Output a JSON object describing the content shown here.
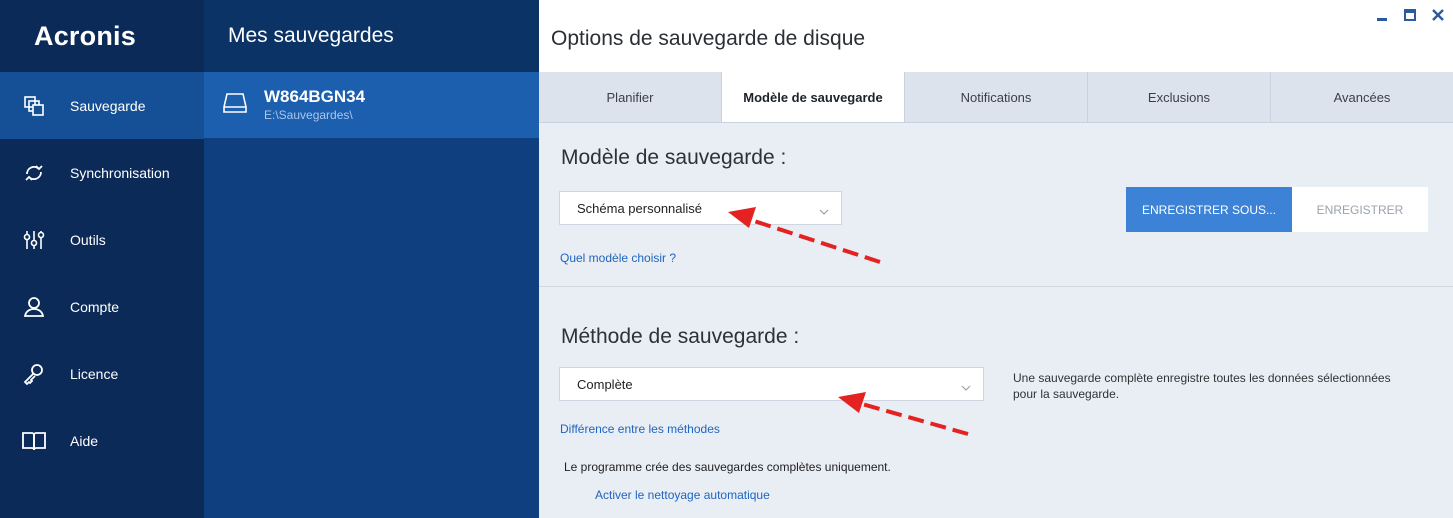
{
  "brand": "Acronis",
  "nav": {
    "items": [
      {
        "label": "Sauvegarde",
        "icon": "backup-icon"
      },
      {
        "label": "Synchronisation",
        "icon": "sync-icon"
      },
      {
        "label": "Outils",
        "icon": "tools-icon"
      },
      {
        "label": "Compte",
        "icon": "account-icon"
      },
      {
        "label": "Licence",
        "icon": "key-icon"
      },
      {
        "label": "Aide",
        "icon": "book-icon"
      }
    ]
  },
  "backups": {
    "header": "Mes sauvegardes",
    "items": [
      {
        "name": "W864BGN34",
        "path": "E:\\Sauvegardes\\",
        "icon": "drive-icon"
      }
    ]
  },
  "main": {
    "title": "Options de sauvegarde de disque",
    "tabs": [
      {
        "label": "Planifier"
      },
      {
        "label": "Modèle de sauvegarde"
      },
      {
        "label": "Notifications"
      },
      {
        "label": "Exclusions"
      },
      {
        "label": "Avancées"
      }
    ],
    "active_tab": "Modèle de sauvegarde",
    "scheme": {
      "title": "Modèle de sauvegarde :",
      "selected": "Schéma personnalisé",
      "help_link": "Quel modèle choisir ?",
      "save_as_label": "ENREGISTRER SOUS...",
      "save_label": "ENREGISTRER"
    },
    "method": {
      "title": "Méthode de sauvegarde :",
      "selected": "Complète",
      "description": "Une sauvegarde complète enregistre toutes les données sélectionnées pour la sauvegarde.",
      "help_link": "Différence entre les méthodes",
      "note": "Le programme crée des sauvegardes complètes uniquement.",
      "cleanup_link": "Activer le nettoyage automatique"
    }
  },
  "colors": {
    "nav_bg": "#0b2a57",
    "nav_active": "#154f95",
    "list_bg": "#0f3f7e",
    "item_selected": "#1b5fae",
    "accent": "#3c82d6",
    "link": "#1e65c0",
    "annotation_arrow": "#e52222"
  }
}
